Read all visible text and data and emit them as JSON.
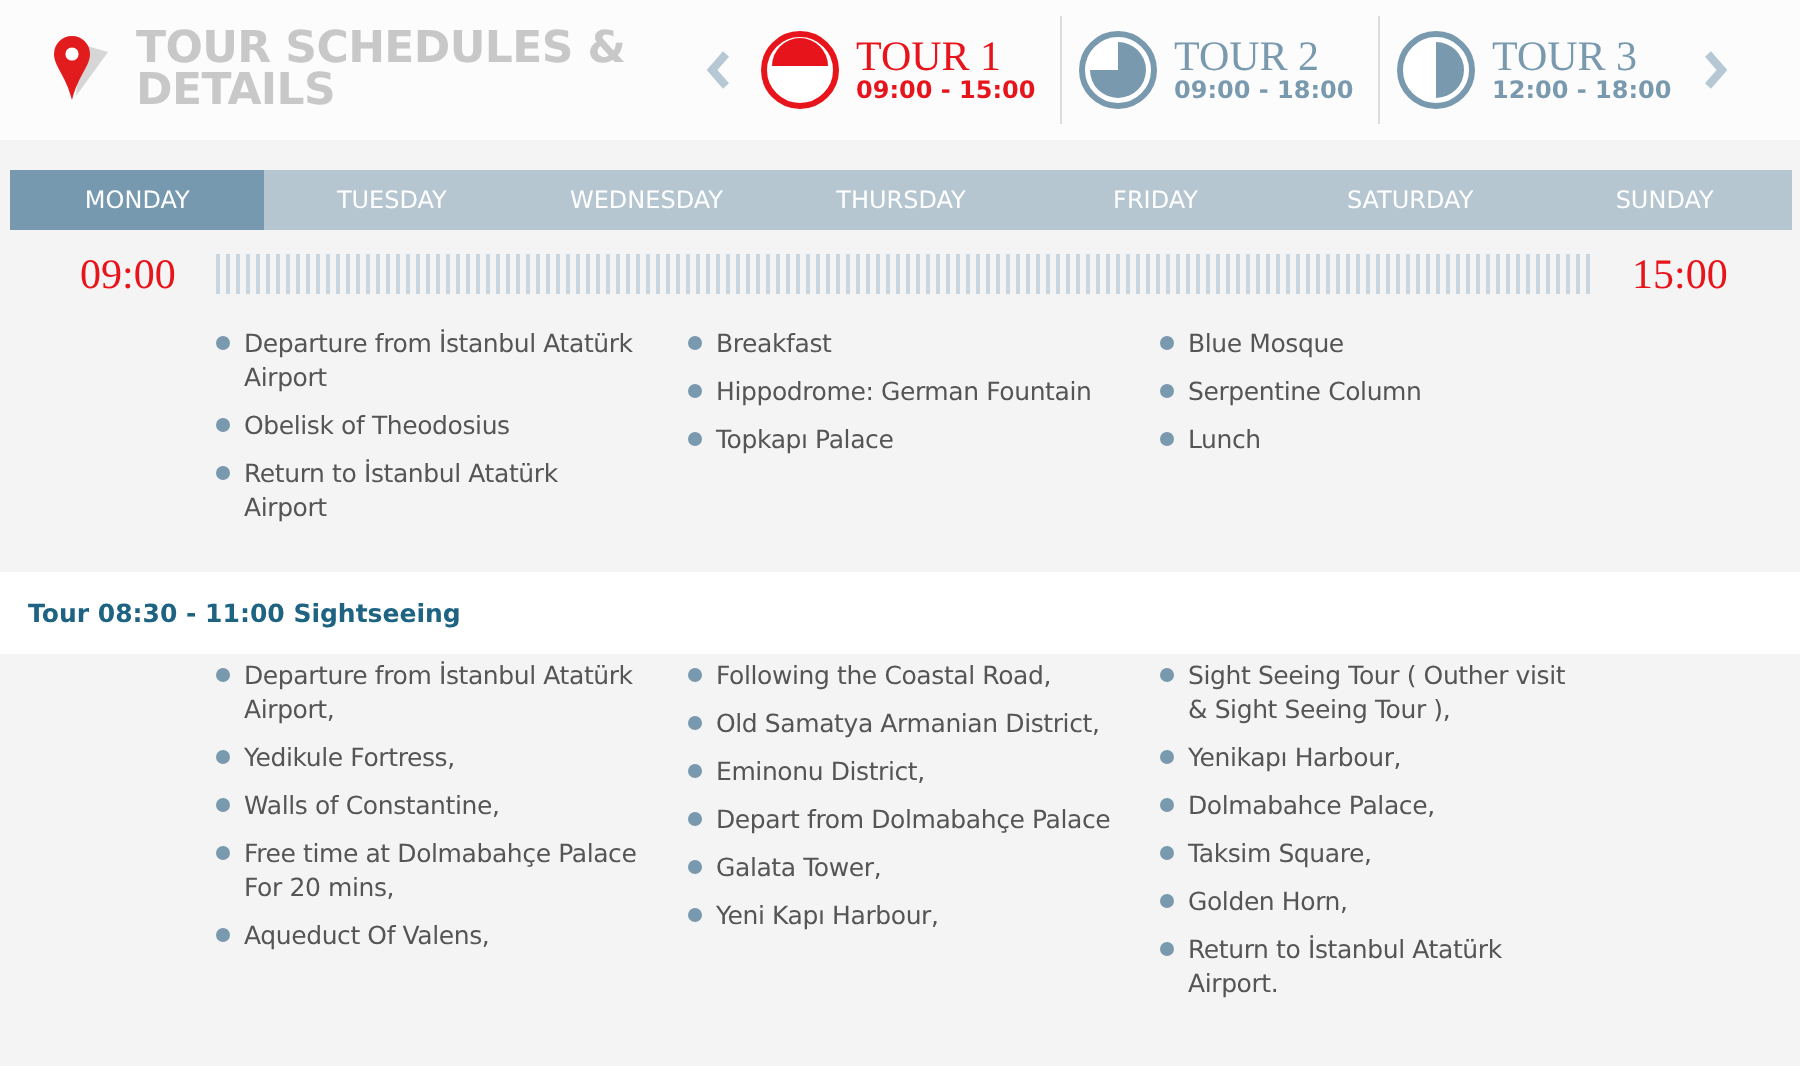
{
  "header": {
    "title": "TOUR SCHEDULES & DETAILS"
  },
  "tours": [
    {
      "name": "TOUR 1",
      "hours": "09:00 - 15:00",
      "kind": "top-half",
      "selected": true
    },
    {
      "name": "TOUR 2",
      "hours": "09:00 - 18:00",
      "kind": "three-quarter",
      "selected": false
    },
    {
      "name": "TOUR 3",
      "hours": "12:00 - 18:00",
      "kind": "right-half",
      "selected": false
    }
  ],
  "days": [
    {
      "label": "MONDAY",
      "selected": true
    },
    {
      "label": "TUESDAY",
      "selected": false
    },
    {
      "label": "WEDNESDAY",
      "selected": false
    },
    {
      "label": "THURSDAY",
      "selected": false
    },
    {
      "label": "FRIDAY",
      "selected": false
    },
    {
      "label": "SATURDAY",
      "selected": false
    },
    {
      "label": "SUNDAY",
      "selected": false
    }
  ],
  "timeline": {
    "start": "09:00",
    "end": "15:00"
  },
  "schedule": {
    "columns": [
      [
        "Departure from İstanbul Atatürk Airport",
        "Obelisk of Theodosius",
        "Return to İstanbul Atatürk Airport"
      ],
      [
        "Breakfast",
        "Hippodrome: German Fountain",
        "Topkapı Palace"
      ],
      [
        "Blue Mosque",
        "Serpentine Column",
        "Lunch"
      ]
    ]
  },
  "sections": [
    {
      "title": "Tour 08:30 - 11:00 Sightseeing",
      "columns": [
        [
          "Departure from İstanbul Atatürk Airport,",
          "Yedikule Fortress,",
          "Walls of Constantine,",
          "Free time at Dolmabahçe Palace For 20 mins,",
          "Aqueduct Of Valens,"
        ],
        [
          "Following the Coastal Road,",
          "Old Samatya Armanian District,",
          "Eminonu District,",
          "Depart from Dolmabahçe Palace",
          "Galata Tower,",
          "Yeni Kapı Harbour,"
        ],
        [
          "Sight Seeing Tour ( Outher visit & Sight Seeing Tour ),",
          "Yenikapı Harbour,",
          "Dolmabahce Palace,",
          "Taksim Square,",
          "Golden Horn,",
          "Return to İstanbul Atatürk Airport."
        ]
      ]
    }
  ]
}
